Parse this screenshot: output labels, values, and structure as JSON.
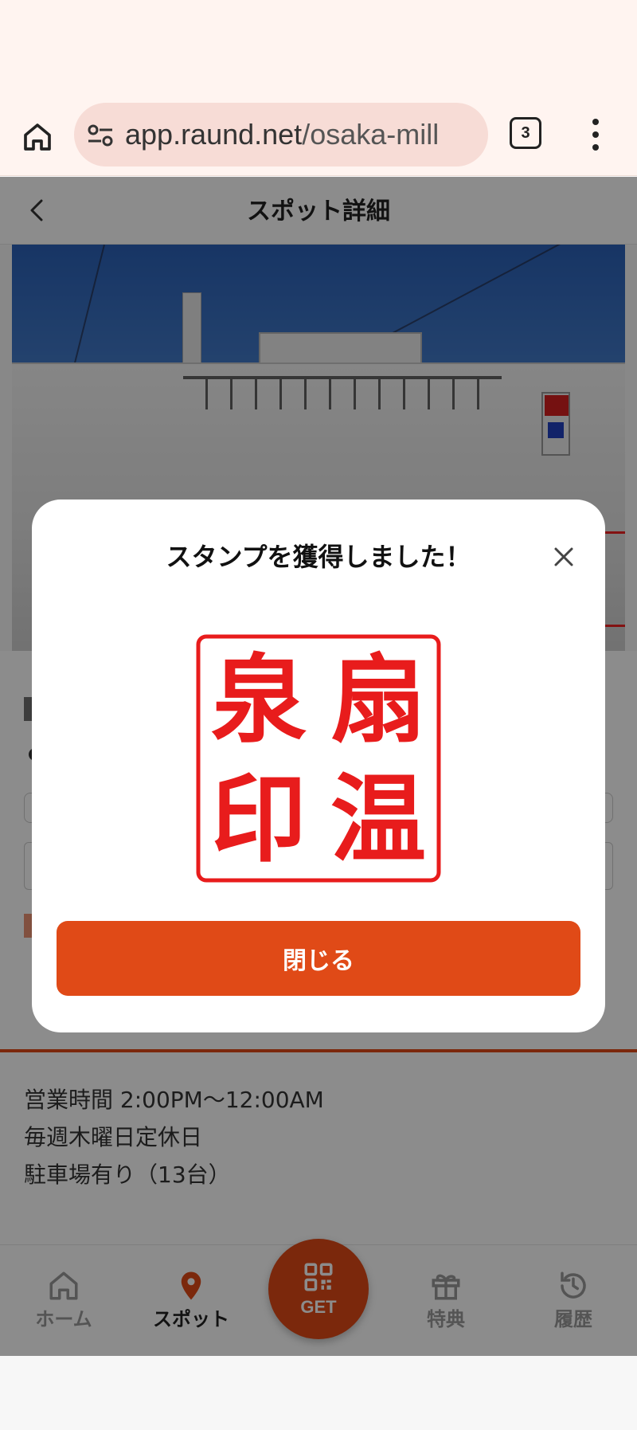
{
  "browser": {
    "url_domain": "app.raund.net",
    "url_path": "/osaka-mill",
    "tab_count": "3",
    "icons": {
      "home": "home-icon",
      "site_settings": "tune-icon",
      "menu": "more-vert-icon"
    }
  },
  "header": {
    "title": "スポット詳細",
    "back_icon": "chevron-left-icon"
  },
  "spot": {
    "info_lines": [
      "営業時間 2:00PM〜12:00AM",
      "毎週木曜日定休日",
      "駐車場有り（13台）"
    ]
  },
  "modal": {
    "title": "スタンプを獲得しました！",
    "close_button_label": "閉じる",
    "close_icon": "close-icon",
    "stamp_chars": [
      "扇",
      "温",
      "泉",
      "印"
    ]
  },
  "nav": {
    "items": [
      {
        "label": "ホーム",
        "icon": "home-icon",
        "active": false
      },
      {
        "label": "スポット",
        "icon": "map-pin-icon",
        "active": true
      },
      {
        "label": "GET",
        "icon": "qr-code-icon",
        "active": false
      },
      {
        "label": "特典",
        "icon": "gift-icon",
        "active": false
      },
      {
        "label": "履歴",
        "icon": "history-icon",
        "active": false
      }
    ]
  },
  "colors": {
    "accent": "#e04a17",
    "stamp_red": "#e81c1c",
    "browser_bar": "#fff4f0",
    "url_pill": "#f7dcd6"
  }
}
